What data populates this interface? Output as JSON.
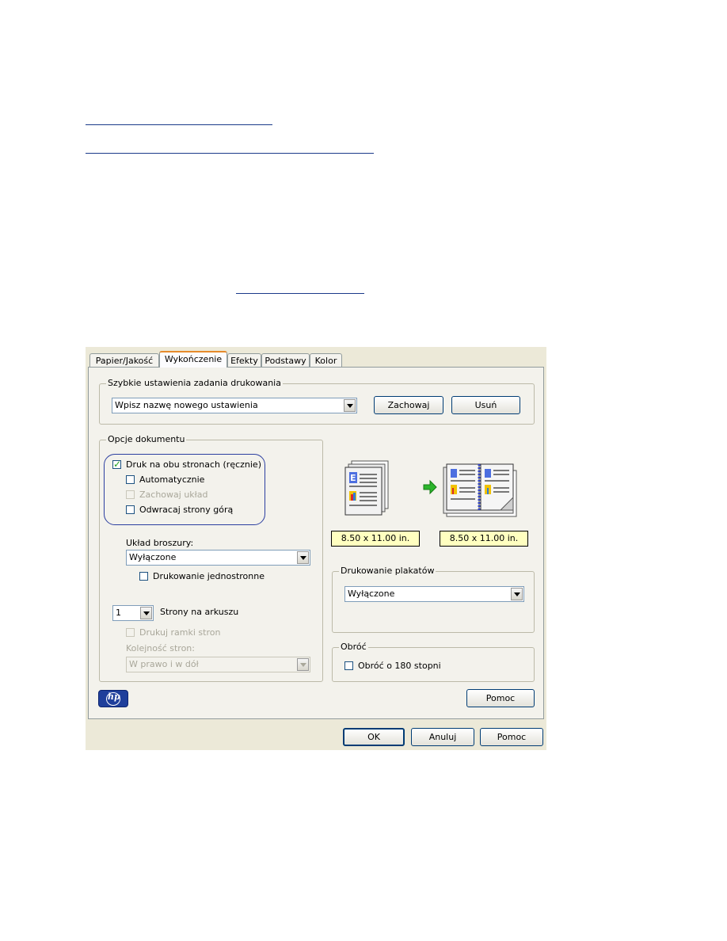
{
  "tabs": [
    "Papier/Jakość",
    "Wykończenie",
    "Efekty",
    "Podstawy",
    "Kolor"
  ],
  "quick_settings": {
    "legend": "Szybkie ustawienia zadania drukowania",
    "combo_value": "Wpisz nazwę nowego ustawienia",
    "save_button": "Zachowaj",
    "delete_button": "Usuń"
  },
  "document_options": {
    "legend": "Opcje dokumentu",
    "duplex_manual": "Druk na obu stronach (ręcznie)",
    "automatic": "Automatycznie",
    "keep_layout": "Zachowaj układ",
    "flip_pages": "Odwracaj strony górą",
    "booklet_label": "Układ broszury:",
    "booklet_value": "Wyłączone",
    "single_sided": "Drukowanie jednostronne",
    "pages_per_sheet_value": "1",
    "pages_per_sheet_label": "Strony na arkuszu",
    "print_borders": "Drukuj ramki stron",
    "page_order_label": "Kolejność stron:",
    "page_order_value": "W prawo i w dół"
  },
  "preview": {
    "size_left": "8.50 x 11.00 in.",
    "size_right": "8.50 x 11.00 in."
  },
  "poster": {
    "legend": "Drukowanie plakatów",
    "value": "Wyłączone"
  },
  "rotate": {
    "legend": "Obróć",
    "option": "Obróć o 180 stopni"
  },
  "buttons": {
    "help_inner": "Pomoc",
    "ok": "OK",
    "cancel": "Anuluj",
    "help": "Pomoc"
  },
  "logo_text": "hp",
  "colors": {
    "dialog_bg": "#ece9d8",
    "active_tab_accent": "#e68b2c",
    "highlight_ring": "#2b3ea0",
    "size_box": "#ffffc0",
    "arrow_green": "#2bb52b"
  }
}
